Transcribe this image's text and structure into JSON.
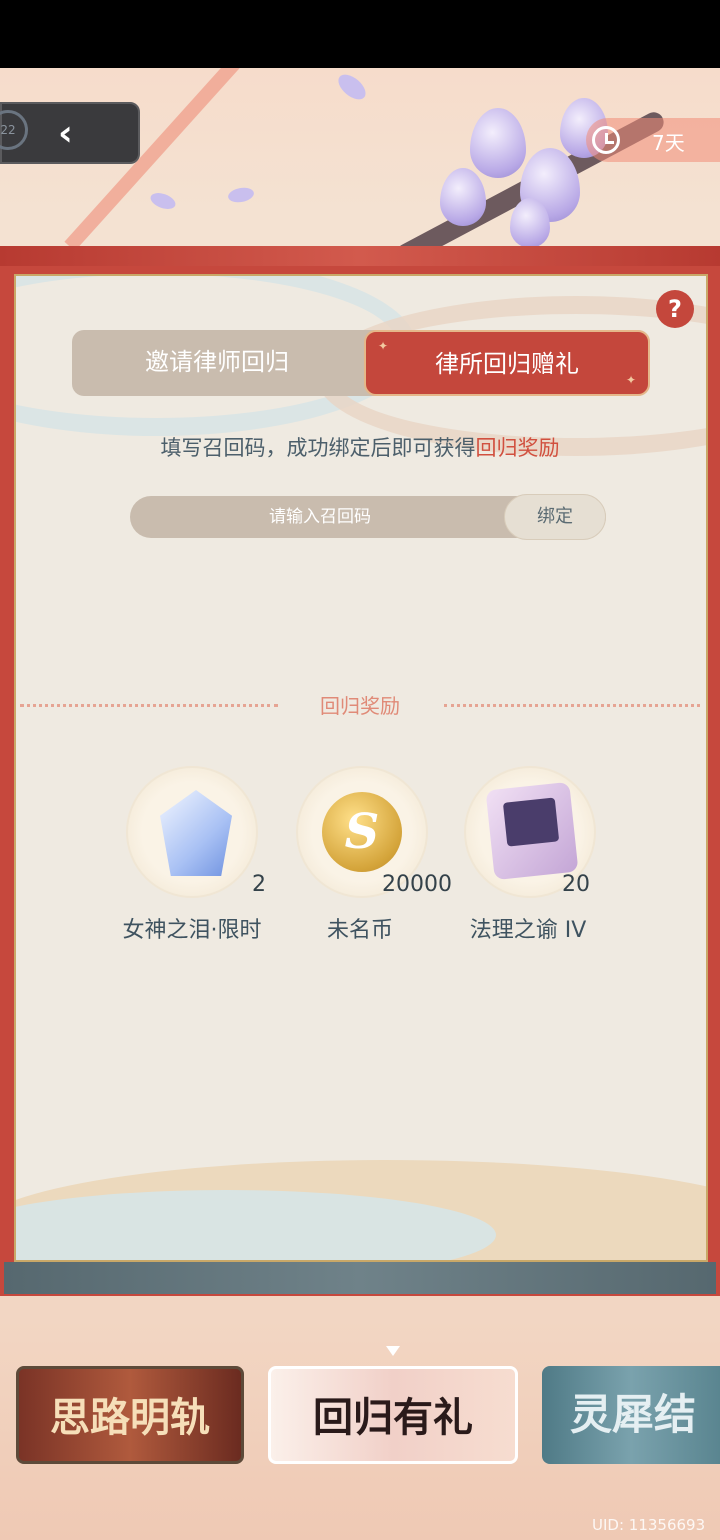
{
  "header": {
    "back_badge": "22",
    "back_icon": "chevron-left-icon",
    "timer_icon": "clock-icon",
    "timer_text": "7天"
  },
  "panel": {
    "help_label": "?",
    "tabs": [
      {
        "label": "邀请律师回归",
        "active": false
      },
      {
        "label": "律所回归赠礼",
        "active": true
      }
    ],
    "instruction": "填写召回码，成功绑定后即可获得",
    "instruction_highlight": "回归奖励",
    "code_placeholder": "请输入召回码",
    "code_value": "",
    "bind_label": "绑定",
    "section_title": "回归奖励",
    "rewards": [
      {
        "name": "女神之泪·限时",
        "qty": "2",
        "icon": "gem-icon"
      },
      {
        "name": "未名币",
        "qty": "20000",
        "icon": "coin-icon"
      },
      {
        "name": "法理之谕 IV",
        "qty": "20",
        "icon": "chip-icon"
      }
    ]
  },
  "banners": [
    {
      "label": "思路明轨"
    },
    {
      "label": "回归有礼",
      "selected": true
    },
    {
      "label": "灵犀结"
    }
  ],
  "uid": "UID: 11356693",
  "colors": {
    "accent_red": "#c4473c",
    "tab_inactive": "#c9bcae",
    "highlight_text": "#d1503f",
    "panel_bg": "#efeae1"
  }
}
